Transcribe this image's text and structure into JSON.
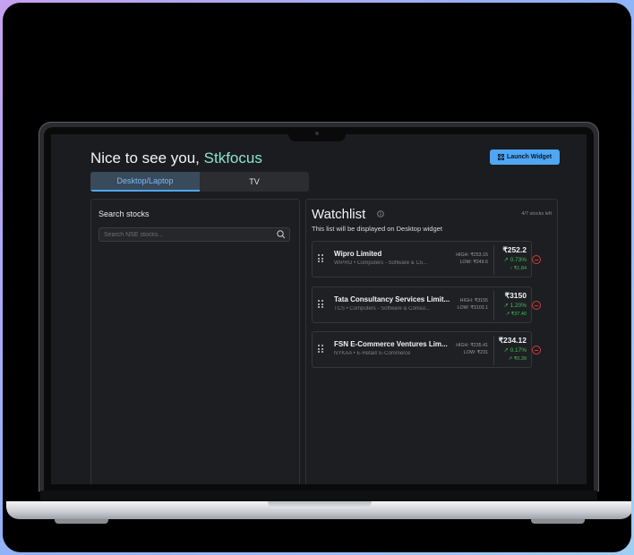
{
  "header": {
    "greeting": "Nice to see you,",
    "brand": "Stkfocus",
    "launch_button": "Launch Widget"
  },
  "tabs": [
    {
      "label": "Desktop/Laptop",
      "active": true
    },
    {
      "label": "TV",
      "active": false
    }
  ],
  "search": {
    "title": "Search stocks",
    "placeholder": "Search NSE stocks..."
  },
  "watchlist": {
    "title": "Watchlist",
    "count_text": "4/7 stocks left",
    "subtitle": "This list will be displayed on Desktop widget",
    "stocks": [
      {
        "name": "Wipro Limited",
        "meta": "WIPRO • Computers - Software & Co...",
        "high": "HIGH: ₹253.15",
        "low": "LOW: ₹249.6",
        "price": "₹252.2",
        "pct": "↗ 0.73%",
        "change": "↑ ₹1.84"
      },
      {
        "name": "Tata Consultancy Services Limit...",
        "meta": "TCS • Computers - Software & Consul...",
        "high": "HIGH: ₹3155",
        "low": "LOW: ₹3103.1",
        "price": "₹3150",
        "pct": "↗ 1.20%",
        "change": "↗ ₹37.40"
      },
      {
        "name": "FSN E-Commerce Ventures Lim...",
        "meta": "NYKAA • E-Retail/ E-Commerce",
        "high": "HIGH: ₹235.41",
        "low": "LOW: ₹231",
        "price": "₹234.12",
        "pct": "↗ 0.17%",
        "change": "↗ ₹0.39"
      }
    ]
  },
  "colors": {
    "accent": "#4ea6f4",
    "brand": "#8be3d0",
    "positive": "#3fbf5a",
    "remove": "#d33b3b"
  }
}
